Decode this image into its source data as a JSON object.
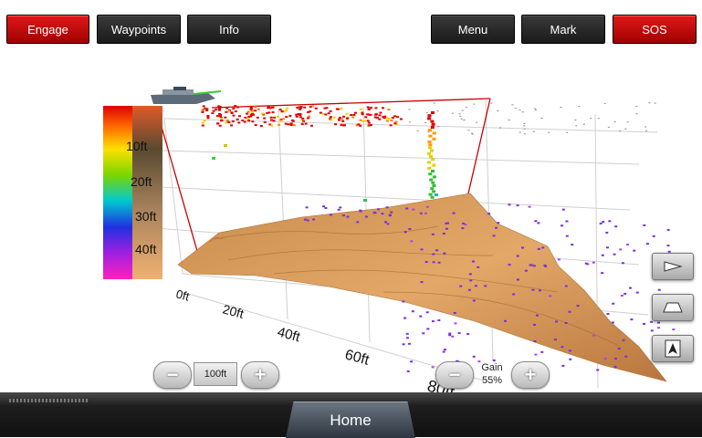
{
  "depth_scale": {
    "labels": [
      "10ft",
      "20ft",
      "30ft",
      "40ft"
    ]
  },
  "distance_scale": {
    "labels": [
      "0ft",
      "20ft",
      "40ft",
      "60ft",
      "80ft"
    ]
  },
  "range_control": {
    "minus_label": "−",
    "value": "100ft",
    "plus_label": "+"
  },
  "gain_control": {
    "minus_label": "−",
    "title": "Gain",
    "value": "55%",
    "plus_label": "+"
  },
  "side_buttons": [
    {
      "name": "view-angle-side",
      "icon": "perspective-side-icon"
    },
    {
      "name": "view-angle-front",
      "icon": "perspective-front-icon"
    },
    {
      "name": "view-top",
      "icon": "north-arrow-icon"
    }
  ],
  "footer": {
    "engage": "Engage",
    "waypoints": "Waypoints",
    "info": "Info",
    "home": "Home",
    "menu": "Menu",
    "mark": "Mark",
    "sos": "SOS"
  },
  "colors": {
    "accent_red": "#cc0000",
    "seabed": "#d49a5a",
    "fish_targets": "#7a2ee0"
  }
}
